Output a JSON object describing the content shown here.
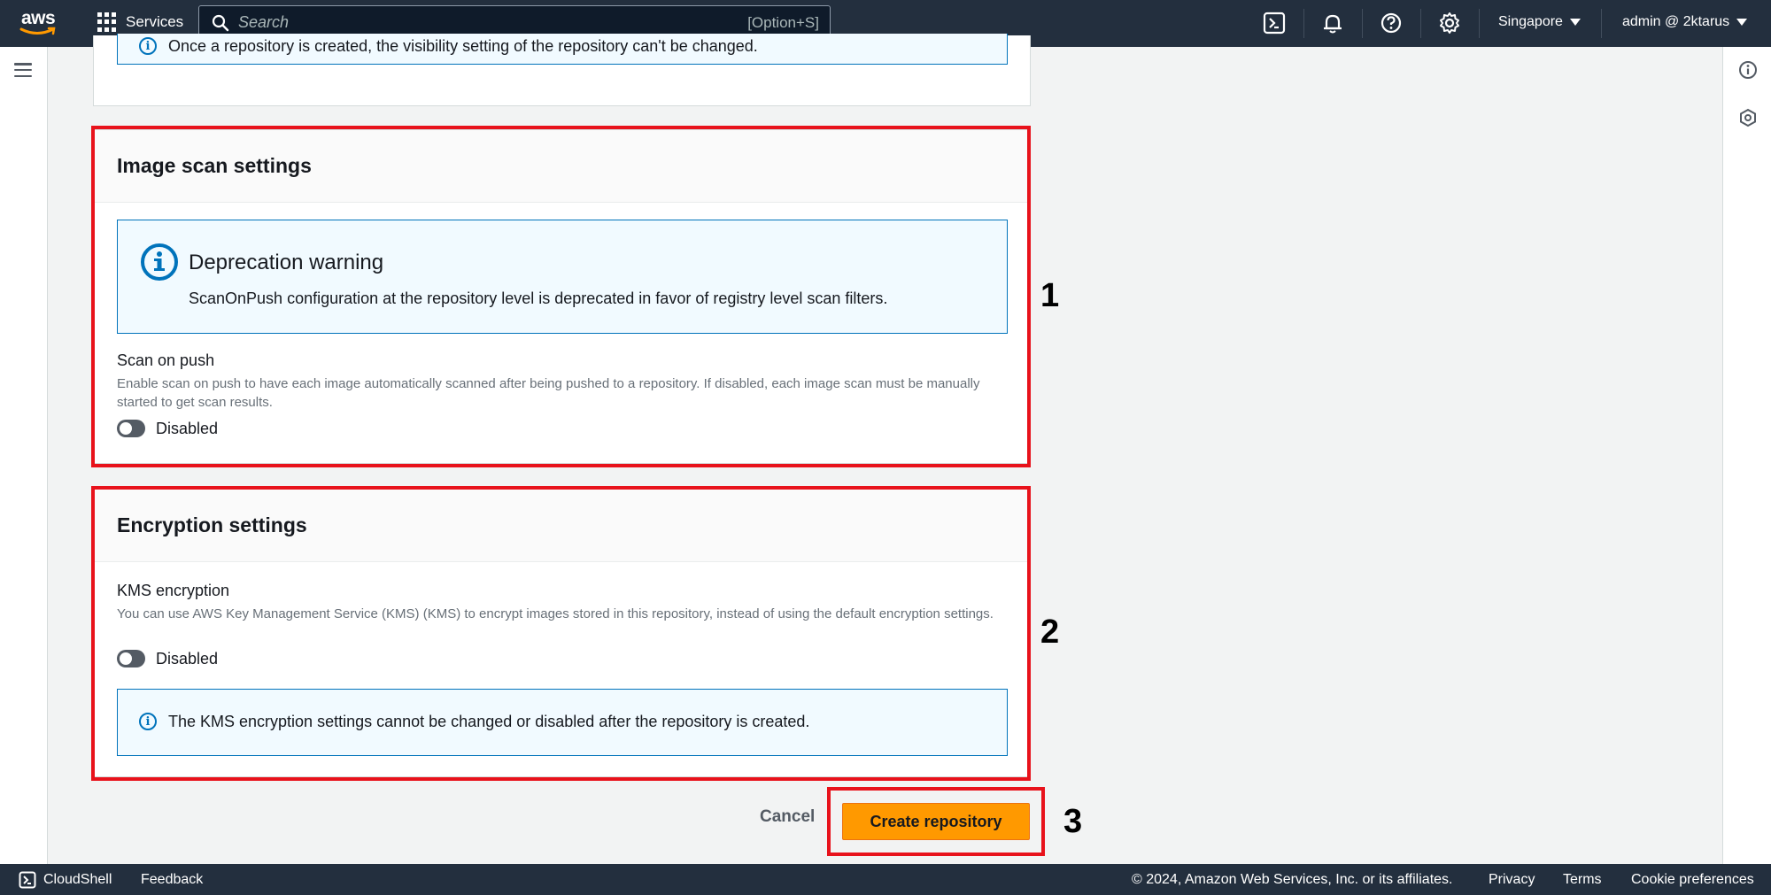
{
  "topnav": {
    "logo_text": "aws",
    "services_label": "Services",
    "search_placeholder": "Search",
    "search_shortcut": "[Option+S]",
    "region": "Singapore",
    "account": "admin @ 2ktarus"
  },
  "top_panel": {
    "info_text": "Once a repository is created, the visibility setting of the repository can't be changed."
  },
  "image_scan": {
    "title": "Image scan settings",
    "warning_title": "Deprecation warning",
    "warning_text": "ScanOnPush configuration at the repository level is deprecated in favor of registry level scan filters.",
    "scan_label": "Scan on push",
    "scan_desc": "Enable scan on push to have each image automatically scanned after being pushed to a repository. If disabled, each image scan must be manually started to get scan results.",
    "toggle_label": "Disabled"
  },
  "encryption": {
    "title": "Encryption settings",
    "kms_label": "KMS encryption",
    "kms_desc": "You can use AWS Key Management Service (KMS) (KMS) to encrypt images stored in this repository, instead of using the default encryption settings.",
    "toggle_label": "Disabled",
    "info_text": "The KMS encryption settings cannot be changed or disabled after the repository is created."
  },
  "actions": {
    "cancel_label": "Cancel",
    "create_label": "Create repository"
  },
  "annotations": {
    "step1": "1",
    "step2": "2",
    "step3": "3"
  },
  "footer": {
    "cloudshell": "CloudShell",
    "feedback": "Feedback",
    "copyright": "© 2024, Amazon Web Services, Inc. or its affiliates.",
    "privacy": "Privacy",
    "terms": "Terms",
    "cookies": "Cookie preferences"
  },
  "colors": {
    "nav_bg": "#232f3e",
    "primary_button": "#ff9900",
    "info_border": "#0073bb",
    "annotation_red": "#e8121b"
  }
}
